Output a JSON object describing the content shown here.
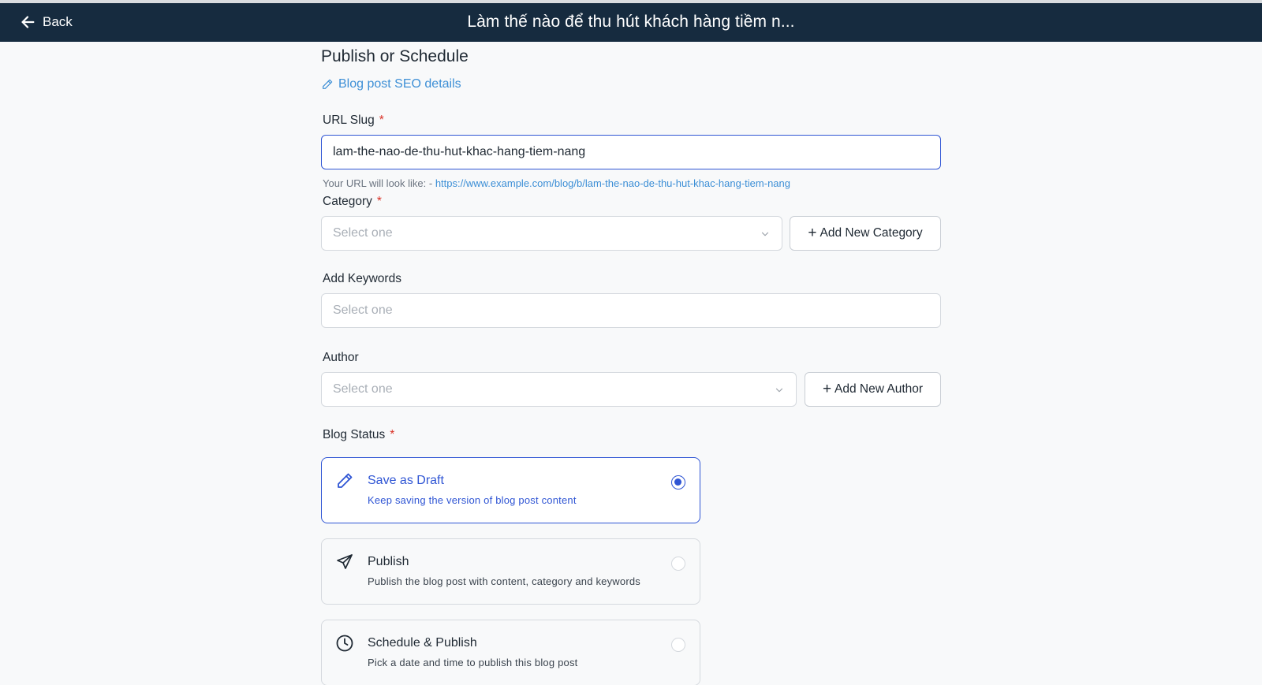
{
  "header": {
    "back_label": "Back",
    "title": "Làm thế nào để thu hút khách hàng tiềm n..."
  },
  "section_title": "Publish or Schedule",
  "seo_link": "Blog post SEO details",
  "url_slug": {
    "label": "URL Slug",
    "required_mark": "*",
    "value": "lam-the-nao-de-thu-hut-khac-hang-tiem-nang",
    "hint_prefix": "Your URL will look like: -",
    "hint_url": "https://www.example.com/blog/b/lam-the-nao-de-thu-hut-khac-hang-tiem-nang"
  },
  "category": {
    "label": "Category",
    "required_mark": "*",
    "placeholder": "Select one",
    "add_button": "Add New Category"
  },
  "keywords": {
    "label": "Add Keywords",
    "placeholder": "Select one"
  },
  "author": {
    "label": "Author",
    "placeholder": "Select one",
    "add_button": "Add New Author"
  },
  "blog_status": {
    "label": "Blog Status",
    "required_mark": "*",
    "options": [
      {
        "title": "Save as Draft",
        "description": "Keep saving the version of blog post content",
        "icon": "pencil-icon",
        "selected": true
      },
      {
        "title": "Publish",
        "description": "Publish the blog post with content, category and keywords",
        "icon": "send-icon",
        "selected": false
      },
      {
        "title": "Schedule & Publish",
        "description": "Pick a date and time to publish this blog post",
        "icon": "clock-icon",
        "selected": false
      }
    ]
  },
  "colors": {
    "header_bg": "#162b3f",
    "accent": "#2f55d4",
    "link": "#3d8fd6",
    "required": "#d93025"
  }
}
